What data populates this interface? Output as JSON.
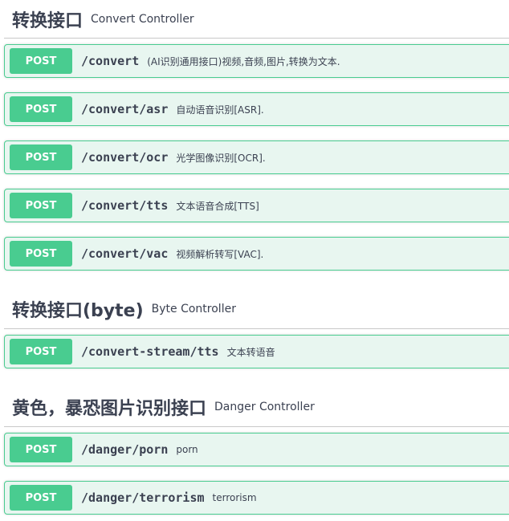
{
  "sections": [
    {
      "title": "转换接口",
      "description": "Convert Controller",
      "operations": [
        {
          "method": "POST",
          "path": "/convert",
          "summary": "(AI识别通用接口)视频,音频,图片,转换为文本."
        },
        {
          "method": "POST",
          "path": "/convert/asr",
          "summary": "自动语音识别[ASR]."
        },
        {
          "method": "POST",
          "path": "/convert/ocr",
          "summary": "光学图像识别[OCR]."
        },
        {
          "method": "POST",
          "path": "/convert/tts",
          "summary": "文本语音合成[TTS]"
        },
        {
          "method": "POST",
          "path": "/convert/vac",
          "summary": "视频解析转写[VAC]."
        }
      ]
    },
    {
      "title": "转换接口(byte)",
      "description": "Byte Controller",
      "operations": [
        {
          "method": "POST",
          "path": "/convert-stream/tts",
          "summary": "文本转语音"
        }
      ]
    },
    {
      "title": "黄色，暴恐图片识别接口",
      "description": "Danger Controller",
      "operations": [
        {
          "method": "POST",
          "path": "/danger/porn",
          "summary": "porn"
        },
        {
          "method": "POST",
          "path": "/danger/terrorism",
          "summary": "terrorism"
        }
      ]
    }
  ],
  "colors": {
    "post_accent": "#49cc90",
    "post_background": "#e8f6f0",
    "text": "#3b4151"
  }
}
